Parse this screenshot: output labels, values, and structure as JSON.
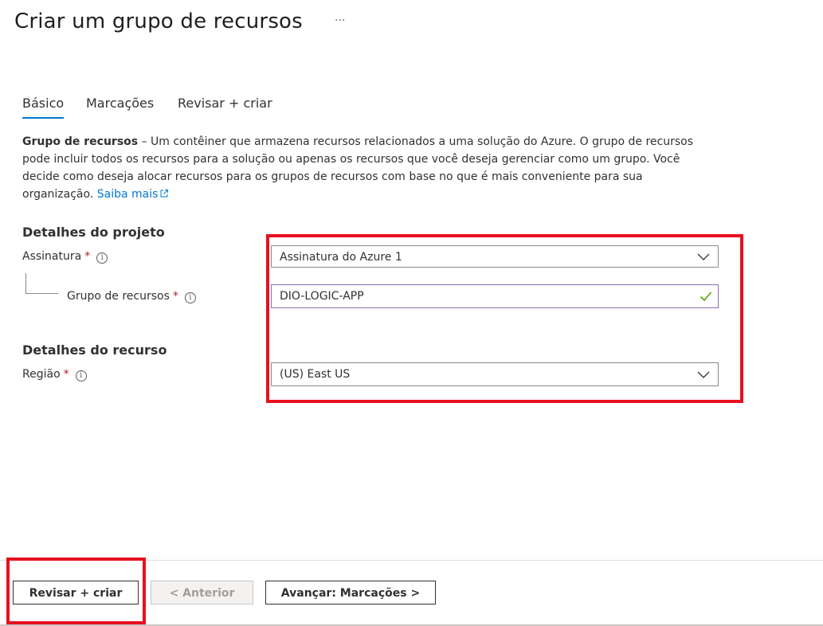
{
  "header": {
    "title": "Criar um grupo de recursos",
    "more_label": "···"
  },
  "tabs": [
    {
      "label": "Básico",
      "active": true
    },
    {
      "label": "Marcações",
      "active": false
    },
    {
      "label": "Revisar + criar",
      "active": false
    }
  ],
  "description": {
    "bold": "Grupo de recursos",
    "text": " – Um contêiner que armazena recursos relacionados a uma solução do Azure. O grupo de recursos pode incluir todos os recursos para a solução ou apenas os recursos que você deseja gerenciar como um grupo. Você decide como deseja alocar recursos para os grupos de recursos com base no que é mais conveniente para sua organização. ",
    "link": "Saiba mais"
  },
  "project": {
    "section_title": "Detalhes do projeto",
    "subscription_label": "Assinatura",
    "subscription_value": "Assinatura do Azure 1",
    "resource_group_label": "Grupo de recursos",
    "resource_group_value": "DIO-LOGIC-APP"
  },
  "resource": {
    "section_title": "Detalhes do recurso",
    "region_label": "Região",
    "region_value": "(US) East US"
  },
  "required_mark": "*",
  "info_glyph": "i",
  "footer": {
    "review_create": "Revisar + criar",
    "previous": "< Anterior",
    "next": "Avançar: Marcações >"
  },
  "colors": {
    "accent": "#0078d4",
    "highlight": "#e8101f",
    "valid_check": "#57a300",
    "required": "#a4262c"
  }
}
